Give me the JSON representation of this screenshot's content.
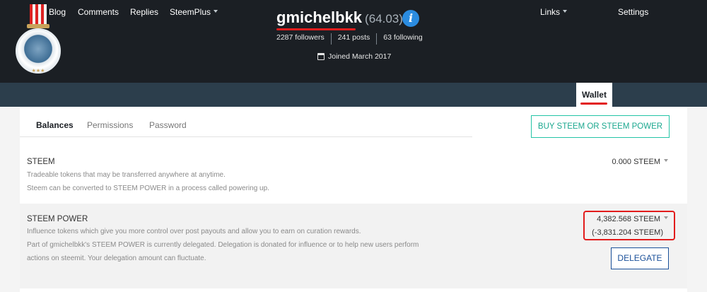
{
  "profile": {
    "name": "gmichelbkk",
    "reputation": "(64.03)",
    "followers": "2287 followers",
    "posts": "241 posts",
    "following": "63 following",
    "joined": "Joined March 2017"
  },
  "nav": {
    "blog": "Blog",
    "comments": "Comments",
    "replies": "Replies",
    "steemplus": "SteemPlus",
    "links": "Links",
    "wallet": "Wallet",
    "settings": "Settings"
  },
  "tabs": {
    "balances": "Balances",
    "permissions": "Permissions",
    "password": "Password"
  },
  "buy_button": "BUY STEEM OR STEEM POWER",
  "steem": {
    "title": "STEEM",
    "desc1": "Tradeable tokens that may be transferred anywhere at anytime.",
    "desc2": "Steem can be converted to STEEM POWER in a process called powering up.",
    "balance": "0.000 STEEM"
  },
  "steem_power": {
    "title": "STEEM POWER",
    "desc1": "Influence tokens which give you more control over post payouts and allow you to earn on curation rewards.",
    "desc2": "Part of gmichelbkk's STEEM POWER is currently delegated. Delegation is donated for influence or to help new users perform",
    "desc3": "actions on steemit. Your delegation amount can fluctuate.",
    "balance": "4,382.568 STEEM",
    "delegated": "(-3,831.204 STEEM)",
    "delegate_button": "DELEGATE"
  },
  "colors": {
    "header_bg": "#1b1f24",
    "navbar_bg": "#2c3e4c",
    "highlight_red": "#e21c1c",
    "buy_green": "#24c4a6",
    "delegate_blue": "#1a5099"
  }
}
